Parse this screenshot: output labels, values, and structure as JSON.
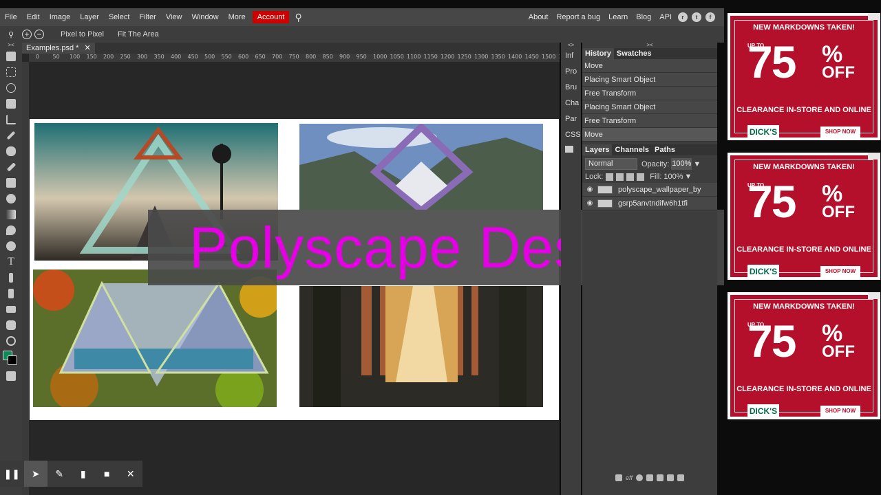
{
  "menubar": {
    "items": [
      "File",
      "Edit",
      "Image",
      "Layer",
      "Select",
      "Filter",
      "View",
      "Window",
      "More"
    ],
    "account": "Account",
    "right_links": [
      "About",
      "Report a bug",
      "Learn",
      "Blog",
      "API"
    ]
  },
  "options": {
    "pixel_to_pixel": "Pixel to Pixel",
    "fit_area": "Fit The Area"
  },
  "document": {
    "tab_title": "Examples.psd *",
    "ruler_ticks": [
      "0",
      "50",
      "100",
      "150",
      "200",
      "250",
      "300",
      "350",
      "400",
      "450",
      "500",
      "550",
      "600",
      "650",
      "700",
      "750",
      "800",
      "850",
      "900",
      "950",
      "1000",
      "1050",
      "1100",
      "1150",
      "1200",
      "1250",
      "1300",
      "1350",
      "1400",
      "1450",
      "1500",
      "1550"
    ]
  },
  "overlay_title": "Polyscape Designs",
  "mini_panel": [
    "Inf",
    "Pro",
    "Bru",
    "Cha",
    "Par",
    "CSS"
  ],
  "history": {
    "tabs": [
      "History",
      "Swatches"
    ],
    "rows": [
      "Move",
      "Placing Smart Object",
      "Free Transform",
      "Placing Smart Object",
      "Free Transform",
      "Move"
    ]
  },
  "layers": {
    "tabs": [
      "Layers",
      "Channels",
      "Paths"
    ],
    "blend_mode": "Normal",
    "opacity_label": "Opacity:",
    "opacity_value": "100%",
    "lock_label": "Lock:",
    "fill_label": "Fill:",
    "fill_value": "100%",
    "rows": [
      "polyscape_wallpaper_by",
      "gsrp5anvtndifw6h1tfi"
    ],
    "footer": "eff"
  },
  "ad": {
    "headline": "NEW MARKDOWNS TAKEN!",
    "upto": "UP TO",
    "big": "75",
    "pct": "%",
    "off": "OFF",
    "clearance": "CLEARANCE IN-STORE AND ONLINE",
    "brand": "DICK'S",
    "cta": "SHOP NOW"
  }
}
